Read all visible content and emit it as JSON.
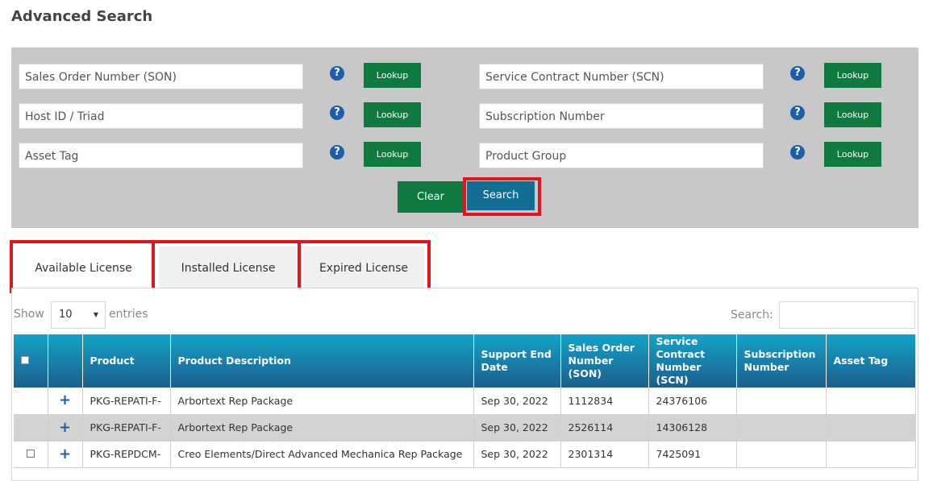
{
  "page_title": "Advanced Search",
  "search_form": {
    "fields": [
      {
        "placeholder": "Sales Order Number (SON)"
      },
      {
        "placeholder": "Host ID / Triad"
      },
      {
        "placeholder": "Asset Tag"
      },
      {
        "placeholder": "Service Contract Number (SCN)"
      },
      {
        "placeholder": "Subscription Number"
      },
      {
        "placeholder": "Product Group"
      }
    ],
    "help_glyph": "?",
    "lookup_label": "Lookup",
    "clear_label": "Clear",
    "search_label": "Search"
  },
  "tabs": [
    {
      "label": "Available License",
      "active": true
    },
    {
      "label": "Installed License",
      "active": false
    },
    {
      "label": "Expired License",
      "active": false
    }
  ],
  "table_controls": {
    "show_label": "Show",
    "page_size": "10",
    "entries_label": "entries",
    "search_label": "Search:"
  },
  "table": {
    "columns": [
      "Product",
      "Product Description",
      "Support End Date",
      "Sales Order Number (SON)",
      "Service Contract Number (SCN)",
      "Subscription Number",
      "Asset Tag"
    ],
    "rows": [
      {
        "product": "PKG-REPATI-F-",
        "description": "Arbortext Rep Package",
        "support_end": "Sep 30, 2022",
        "son": "1112834",
        "scn": "24376106",
        "subscription": "",
        "asset_tag": ""
      },
      {
        "product": "PKG-REPATI-F-",
        "description": "Arbortext Rep Package",
        "support_end": "Sep 30, 2022",
        "son": "2526114",
        "scn": "14306128",
        "subscription": "",
        "asset_tag": ""
      },
      {
        "product": "PKG-REPDCM-",
        "description": "Creo Elements/Direct Advanced Mechanica Rep Package",
        "support_end": "Sep 30, 2022",
        "son": "2301314",
        "scn": "7425091",
        "subscription": "",
        "asset_tag": ""
      }
    ]
  },
  "colors": {
    "lookup_green": "#0f7a3f",
    "search_blue": "#136e95",
    "highlight_red": "#e0151f",
    "header_gradient_top": "#13a3c9",
    "header_gradient_bottom": "#1c5e8c"
  }
}
